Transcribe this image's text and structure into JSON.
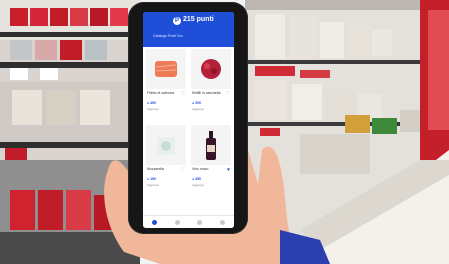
{
  "app": {
    "points": "215 punti",
    "section_label": "Catalogo Punti Oro"
  },
  "products": [
    {
      "name": "Filetto di salmone",
      "points": "● 450",
      "cta": "Aggiungi"
    },
    {
      "name": "Mirtilli in vaschetta",
      "points": "● 200",
      "cta": "Aggiungi"
    },
    {
      "name": "Mozzarella",
      "points": "● 150",
      "cta": "Aggiungi"
    },
    {
      "name": "Vino rosso",
      "points": "● 350",
      "cta": "Aggiungi"
    }
  ],
  "colors": {
    "brand": "#1f4fd8"
  },
  "icons": [
    "points-icon",
    "heart-icon",
    "nav-home-icon",
    "nav-catalog-icon",
    "nav-cart-icon",
    "nav-profile-icon"
  ]
}
